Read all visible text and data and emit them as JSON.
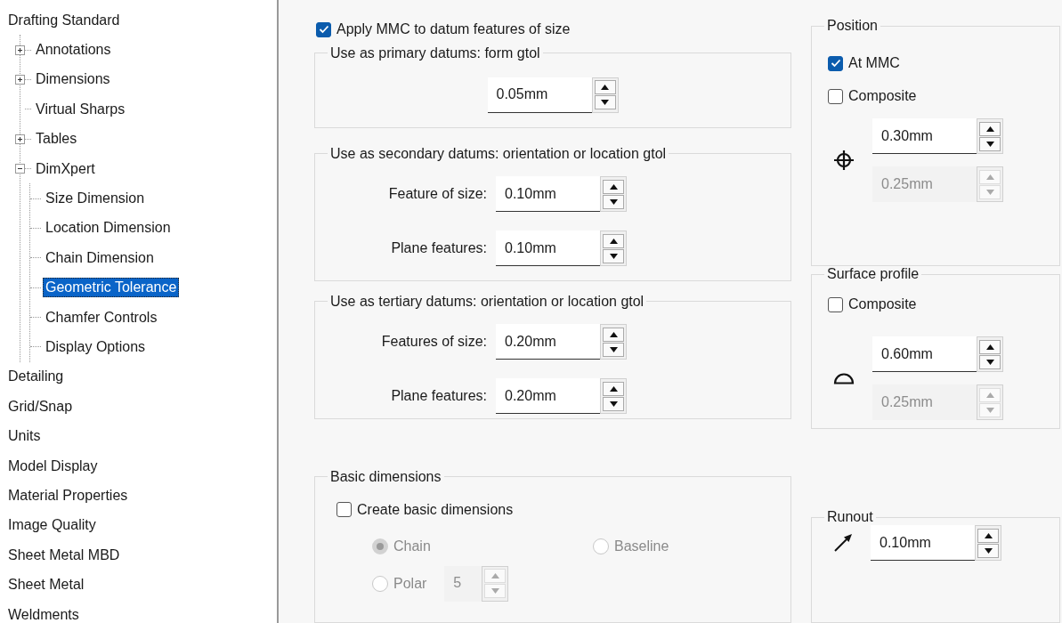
{
  "tree": [
    {
      "label": "Drafting Standard",
      "selected": false,
      "children": [
        {
          "label": "Annotations",
          "kind": "folder",
          "expanded": false,
          "selected": false
        },
        {
          "label": "Dimensions",
          "kind": "folder",
          "expanded": false,
          "selected": false
        },
        {
          "label": "Virtual Sharps",
          "kind": "leaf",
          "selected": false
        },
        {
          "label": "Tables",
          "kind": "folder",
          "expanded": false,
          "selected": false
        },
        {
          "label": "DimXpert",
          "kind": "folder",
          "expanded": true,
          "selected": false,
          "children": [
            {
              "label": "Size Dimension",
              "kind": "leaf",
              "selected": false
            },
            {
              "label": "Location Dimension",
              "kind": "leaf",
              "selected": false
            },
            {
              "label": "Chain Dimension",
              "kind": "leaf",
              "selected": false
            },
            {
              "label": "Geometric Tolerance",
              "kind": "leaf",
              "selected": true
            },
            {
              "label": "Chamfer Controls",
              "kind": "leaf",
              "selected": false
            },
            {
              "label": "Display Options",
              "kind": "leaf",
              "selected": false
            }
          ]
        }
      ]
    },
    {
      "label": "Detailing",
      "selected": false
    },
    {
      "label": "Grid/Snap",
      "selected": false
    },
    {
      "label": "Units",
      "selected": false
    },
    {
      "label": "Model Display",
      "selected": false
    },
    {
      "label": "Material Properties",
      "selected": false
    },
    {
      "label": "Image Quality",
      "selected": false
    },
    {
      "label": "Sheet Metal MBD",
      "selected": false
    },
    {
      "label": "Sheet Metal",
      "selected": false
    },
    {
      "label": "Weldments",
      "selected": false
    }
  ],
  "apply_mmc": {
    "label": "Apply MMC to datum features of size",
    "checked": true
  },
  "primary": {
    "title": "Use as primary datums: form gtol",
    "spinner": {
      "value": "0.05mm",
      "disabled": false
    }
  },
  "secondary": {
    "title": "Use as secondary datums: orientation or location gtol",
    "rows": [
      {
        "label": "Feature of size:",
        "spinner": {
          "value": "0.10mm",
          "disabled": false
        }
      },
      {
        "label": "Plane features:",
        "spinner": {
          "value": "0.10mm",
          "disabled": false
        }
      }
    ]
  },
  "tertiary": {
    "title": "Use as tertiary datums: orientation or location gtol",
    "rows": [
      {
        "label": "Features of size:",
        "spinner": {
          "value": "0.20mm",
          "disabled": false
        }
      },
      {
        "label": "Plane features:",
        "spinner": {
          "value": "0.20mm",
          "disabled": false
        }
      }
    ]
  },
  "basic_dimensions": {
    "title": "Basic dimensions",
    "create": {
      "label": "Create basic dimensions",
      "checked": false
    },
    "disabled": true,
    "options": [
      {
        "label": "Chain",
        "selected": true
      },
      {
        "label": "Baseline",
        "selected": false
      },
      {
        "label": "Polar",
        "selected": false
      }
    ],
    "polar_count": {
      "value": "5",
      "disabled": true
    }
  },
  "position": {
    "title": "Position",
    "at_mmc": {
      "label": "At MMC",
      "checked": true
    },
    "composite": {
      "label": "Composite",
      "checked": false
    },
    "tolerance": {
      "value": "0.30mm",
      "disabled": false
    },
    "composite_tolerance": {
      "value": "0.25mm",
      "disabled": true
    }
  },
  "surface_profile": {
    "title": "Surface profile",
    "composite": {
      "label": "Composite",
      "checked": false
    },
    "tolerance": {
      "value": "0.60mm",
      "disabled": false
    },
    "composite_tolerance": {
      "value": "0.25mm",
      "disabled": true
    }
  },
  "runout": {
    "title": "Runout",
    "tolerance": {
      "value": "0.10mm",
      "disabled": false
    }
  }
}
